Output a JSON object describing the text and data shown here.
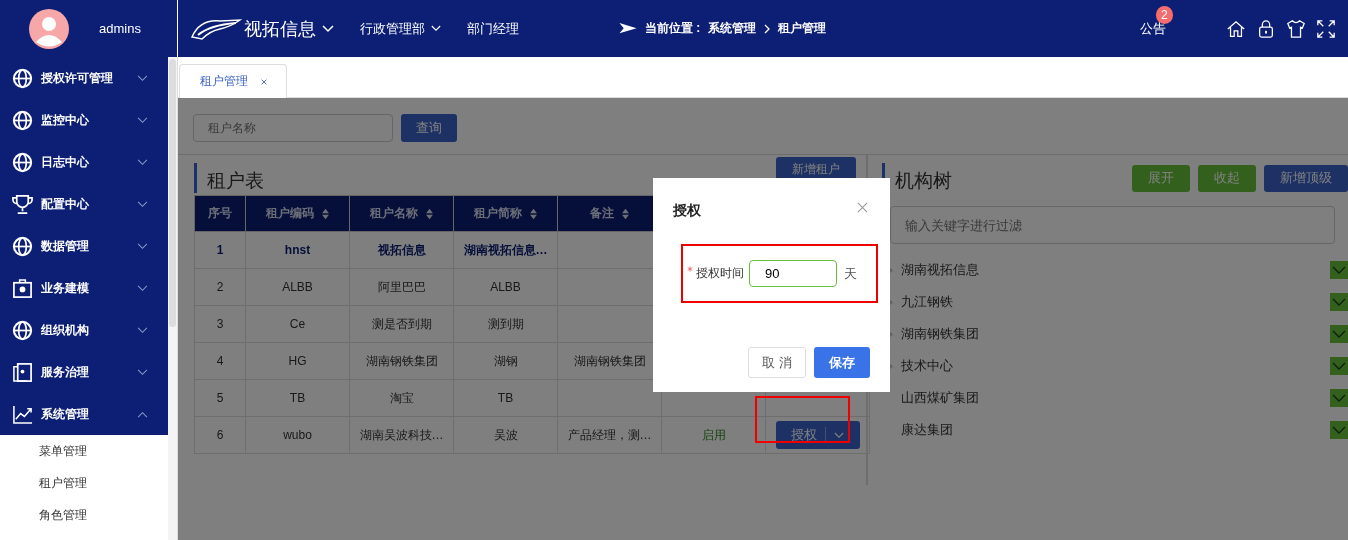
{
  "header": {
    "user": "admins",
    "brand": "视拓信息",
    "department": "行政管理部",
    "role": "部门经理",
    "breadcrumb": {
      "label": "当前位置 :",
      "items": [
        "系统管理",
        "租户管理"
      ]
    },
    "notice": {
      "label": "公告",
      "count": "2"
    }
  },
  "sidebar": {
    "items": [
      {
        "label": "授权许可管理",
        "kind": "globe",
        "expanded": false
      },
      {
        "label": "监控中心",
        "kind": "globe",
        "expanded": false
      },
      {
        "label": "日志中心",
        "kind": "globe",
        "expanded": false
      },
      {
        "label": "配置中心",
        "kind": "trophy",
        "expanded": false
      },
      {
        "label": "数据管理",
        "kind": "globe",
        "expanded": false
      },
      {
        "label": "业务建模",
        "kind": "case",
        "expanded": false
      },
      {
        "label": "组织机构",
        "kind": "globe",
        "expanded": false
      },
      {
        "label": "服务治理",
        "kind": "door",
        "expanded": false
      },
      {
        "label": "系统管理",
        "kind": "chart",
        "expanded": true,
        "children": [
          "菜单管理",
          "租户管理",
          "角色管理"
        ]
      }
    ]
  },
  "tabs": [
    {
      "label": "租户管理",
      "selected": true
    }
  ],
  "search": {
    "placeholder": "租户名称",
    "button": "查询"
  },
  "table": {
    "title": "租户表",
    "add_button": "新增租户",
    "columns": [
      "序号",
      "租户编码",
      "租户名称",
      "租户简称",
      "备注"
    ],
    "rows": [
      {
        "cells": [
          "1",
          "hnst",
          "视拓信息",
          "湖南视拓信息…",
          ""
        ],
        "selected": true
      },
      {
        "cells": [
          "2",
          "ALBB",
          "阿里巴巴",
          "ALBB",
          ""
        ],
        "selected": false
      },
      {
        "cells": [
          "3",
          "Ce",
          "测是否到期",
          "测到期",
          ""
        ],
        "selected": false
      },
      {
        "cells": [
          "4",
          "HG",
          "湖南钢铁集团",
          "湖钢",
          "湖南钢铁集团"
        ],
        "selected": false
      },
      {
        "cells": [
          "5",
          "TB",
          "淘宝",
          "TB",
          ""
        ],
        "selected": false
      },
      {
        "cells": [
          "6",
          "wubo",
          "湖南吴波科技…",
          "吴波",
          "产品经理，测…"
        ],
        "selected": false,
        "status": "启用",
        "action": "授权"
      }
    ]
  },
  "tree": {
    "title": "机构树",
    "buttons": [
      {
        "label": "展开",
        "kind": "green"
      },
      {
        "label": "收起",
        "kind": "green"
      },
      {
        "label": "新增顶级",
        "kind": "blue"
      }
    ],
    "filter_placeholder": "输入关键字进行过滤",
    "nodes": [
      {
        "label": "湖南视拓信息",
        "has_children": true,
        "checked": true
      },
      {
        "label": "九江钢铁",
        "has_children": true,
        "checked": true
      },
      {
        "label": "湖南钢铁集团",
        "has_children": true,
        "checked": true
      },
      {
        "label": "技术中心",
        "has_children": true,
        "checked": true
      },
      {
        "label": "山西煤矿集团",
        "has_children": false,
        "checked": true
      },
      {
        "label": "康达集团",
        "has_children": false,
        "checked": true
      }
    ]
  },
  "dialog": {
    "title": "授权",
    "field": {
      "label": "授权时间",
      "required": true,
      "value": "90",
      "unit": "天"
    },
    "cancel": "取 消",
    "save": "保存"
  }
}
